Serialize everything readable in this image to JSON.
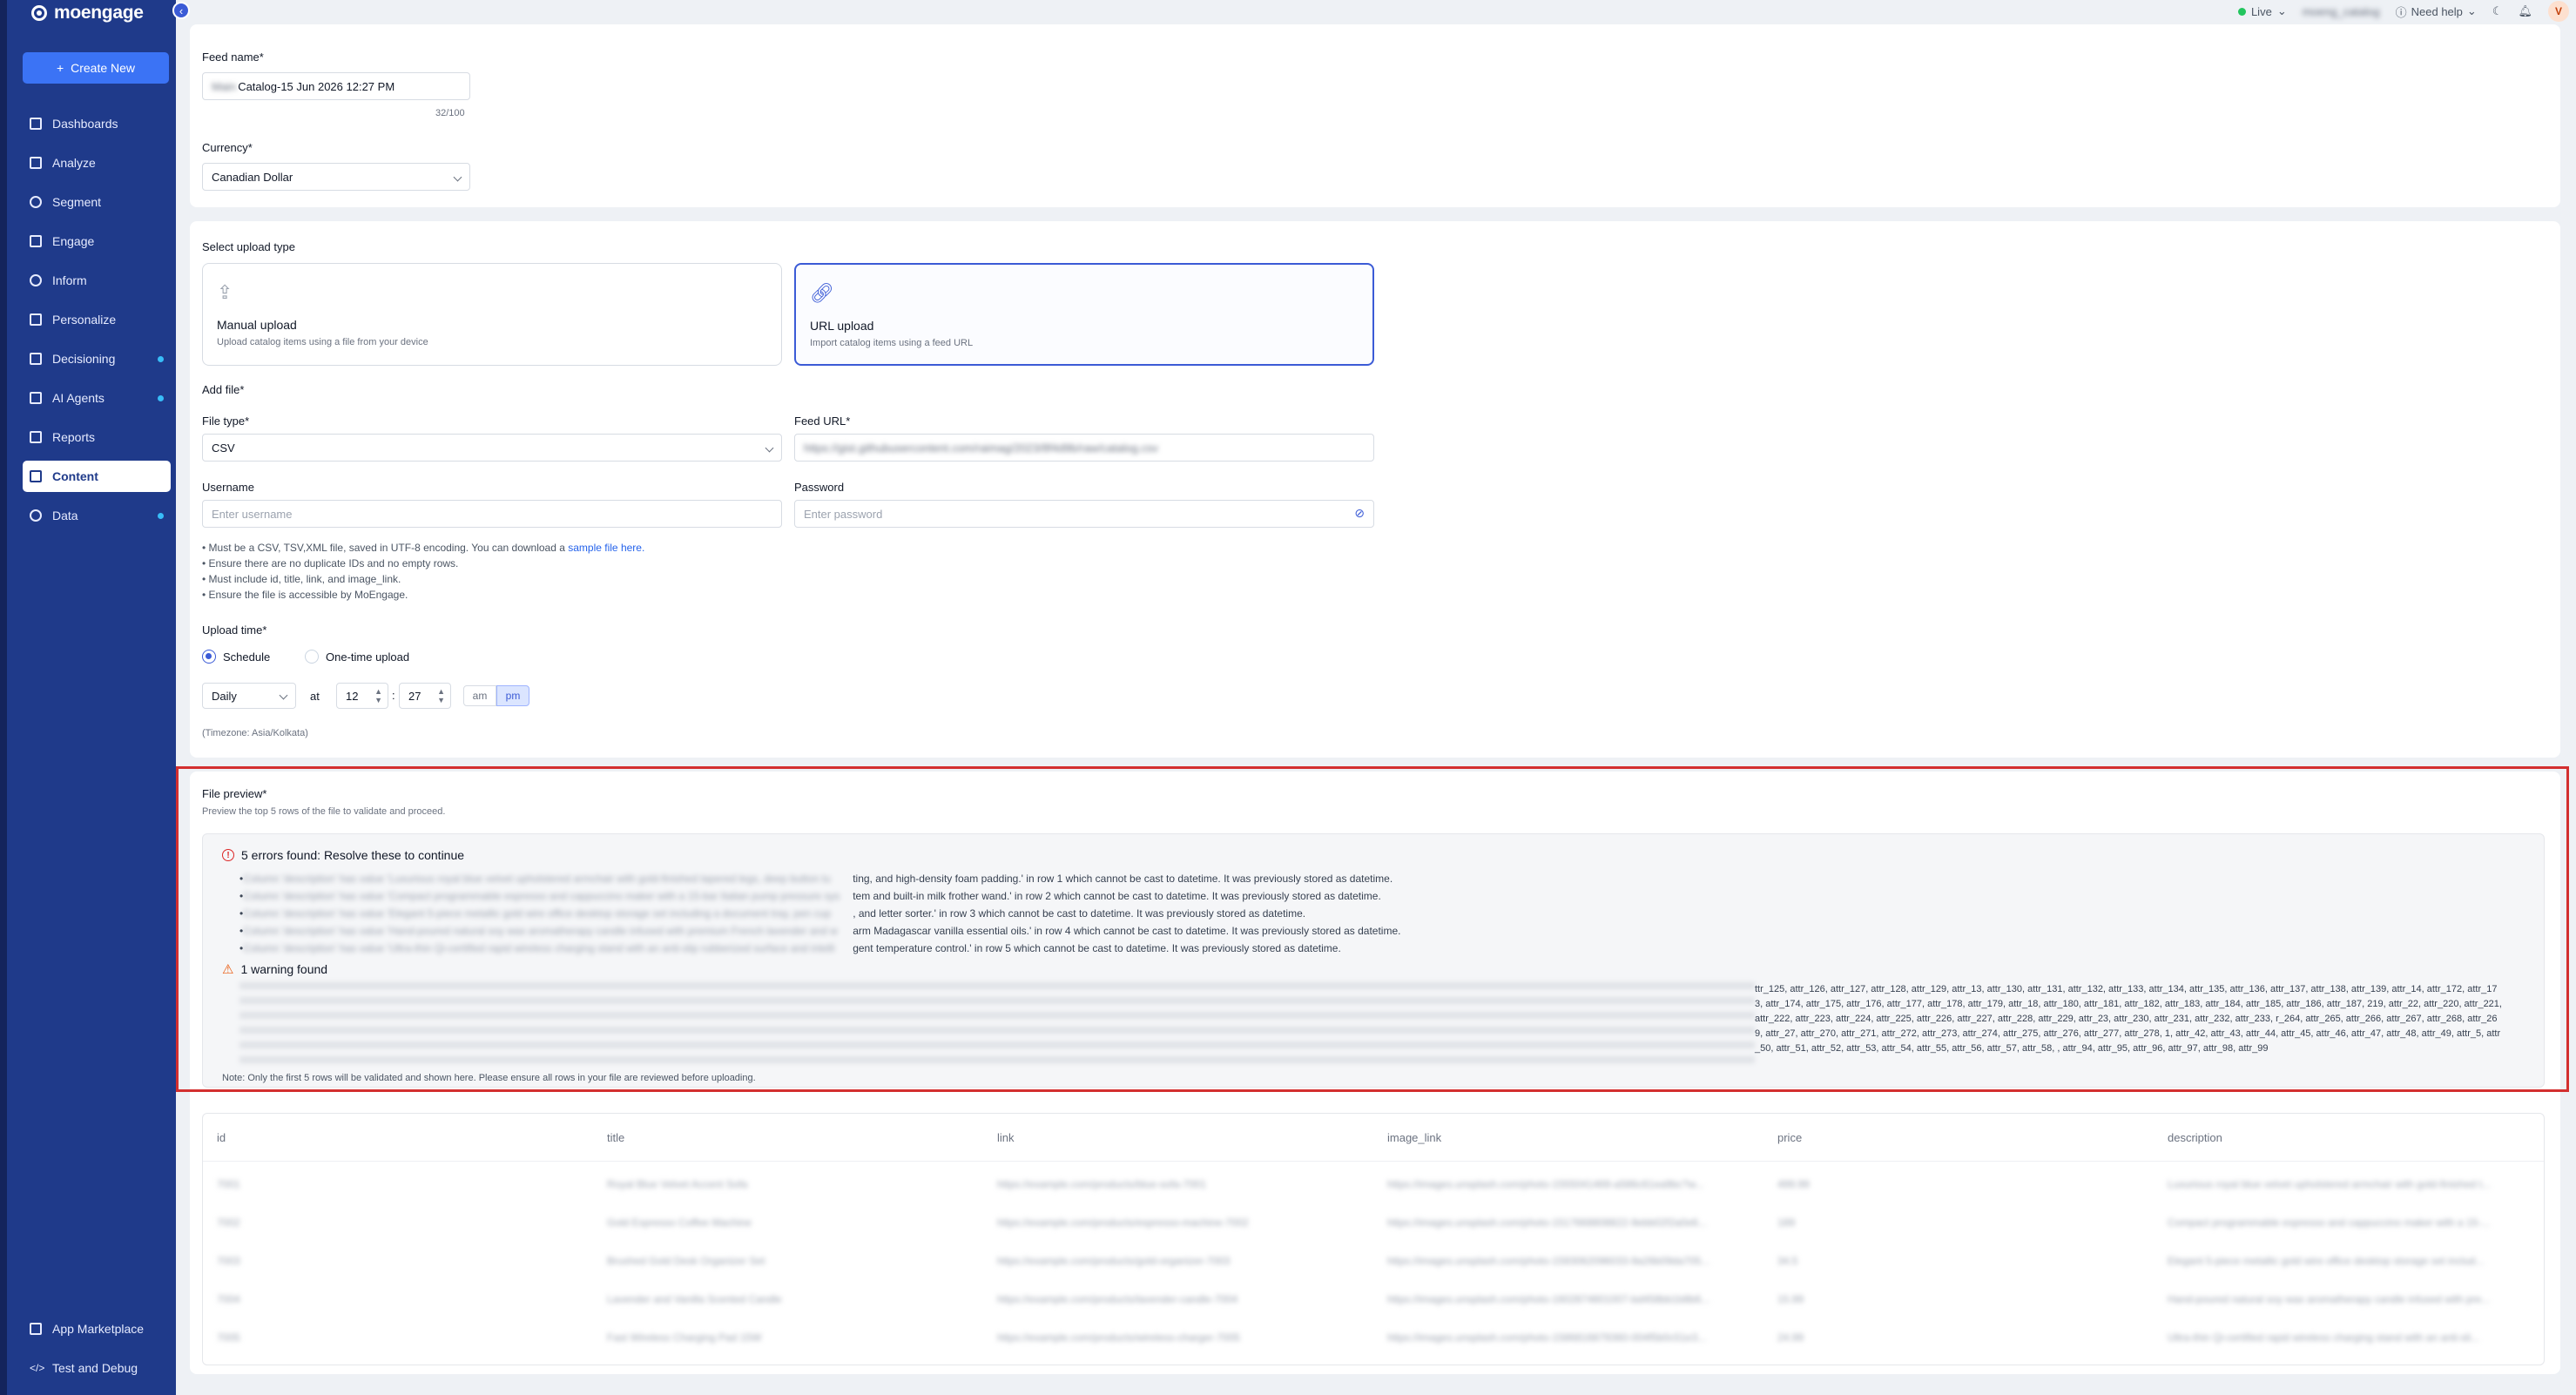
{
  "brand": {
    "logo_text": "moengage"
  },
  "sidebar": {
    "create_label": "Create New",
    "items": [
      {
        "label": "Dashboards",
        "icon": "dashboard-icon"
      },
      {
        "label": "Analyze",
        "icon": "analyze-icon"
      },
      {
        "label": "Segment",
        "icon": "segment-icon"
      },
      {
        "label": "Engage",
        "icon": "megaphone-icon"
      },
      {
        "label": "Inform",
        "icon": "inform-icon"
      },
      {
        "label": "Personalize",
        "icon": "personalize-icon"
      },
      {
        "label": "Decisioning",
        "icon": "sparkle-icon"
      },
      {
        "label": "AI Agents",
        "icon": "robot-icon"
      },
      {
        "label": "Reports",
        "icon": "reports-icon"
      },
      {
        "label": "Content",
        "icon": "content-icon"
      },
      {
        "label": "Data",
        "icon": "database-icon"
      }
    ],
    "bottom_items": [
      {
        "label": "App Marketplace",
        "icon": "marketplace-icon"
      },
      {
        "label": "Test and Debug",
        "icon": "code-icon"
      }
    ]
  },
  "topbar": {
    "live_label": "Live",
    "workspace": "moeng_catalog",
    "help_label": "Need help",
    "avatar_initial": "V"
  },
  "feed": {
    "name_label": "Feed name*",
    "name_prefix": "Main",
    "name_value": "Catalog-15 Jun 2026 12:27 PM",
    "name_counter": "32/100",
    "currency_label": "Currency*",
    "currency_value": "Canadian Dollar"
  },
  "upload": {
    "type_label": "Select upload type",
    "manual_title": "Manual upload",
    "manual_sub": "Upload catalog items using a file from your device",
    "url_title": "URL upload",
    "url_sub": "Import catalog items using a feed URL",
    "add_file_label": "Add file*",
    "file_type_label": "File type*",
    "file_type_value": "CSV",
    "feed_url_label": "Feed URL*",
    "feed_url_value": "https://gist.githubusercontent.com/raimag/2023/8f4d9b/raw/catalog.csv",
    "username_label": "Username",
    "username_placeholder": "Enter username",
    "password_label": "Password",
    "password_placeholder": "Enter password",
    "bullet_1a": "Must be a CSV, TSV,XML file, saved in UTF-8 encoding. You can download a ",
    "bullet_1_link": "sample file here.",
    "bullet_2": "Ensure there are no duplicate IDs and no empty rows.",
    "bullet_3": "Must include id, title, link, and image_link.",
    "bullet_4": "Ensure the file is accessible by MoEngage.",
    "time_label": "Upload time*",
    "schedule_label": "Schedule",
    "onetime_label": "One-time upload",
    "freq_value": "Daily",
    "at_label": "at",
    "hour": "12",
    "colon": ":",
    "minute": "27",
    "am": "am",
    "pm": "pm",
    "timezone": "(Timezone: Asia/Kolkata)"
  },
  "preview": {
    "title": "File preview*",
    "subtitle": "Preview the top 5 rows of the file to validate and proceed.",
    "errors_title": "5 errors found: Resolve these to continue",
    "errors": [
      {
        "blurred": "Column 'description' has value 'Luxurious royal blue velvet upholstered armchair with gold-finished tapered legs, deep button tu",
        "text": "ting, and high-density foam padding.' in row 1 which cannot be cast to datetime. It was previously stored as datetime."
      },
      {
        "blurred": "Column 'description' has value 'Compact programmable espresso and cappuccino maker with a 15-bar Italian pump pressure sys",
        "text": "tem and built-in milk frother wand.' in row 2 which cannot be cast to datetime. It was previously stored as datetime."
      },
      {
        "blurred": "Column 'description' has value 'Elegant 5-piece metallic gold wire office desktop storage set including a document tray, pen cup",
        "text": ", and letter sorter.' in row 3 which cannot be cast to datetime. It was previously stored as datetime."
      },
      {
        "blurred": "Column 'description' has value 'Hand-poured natural soy wax aromatherapy candle infused with premium French lavender and w",
        "text": "arm Madagascar vanilla essential oils.' in row 4 which cannot be cast to datetime. It was previously stored as datetime."
      },
      {
        "blurred": "Column 'description' has value 'Ultra-thin Qi-certified rapid wireless charging stand with an anti-slip rubberized surface and intelli",
        "text": "gent temperature control.' in row 5 which cannot be cast to datetime. It was previously stored as datetime."
      }
    ],
    "warning_title": "1 warning found",
    "warning_text": "ttr_125, attr_126, attr_127, attr_128, attr_129, attr_13, attr_130, attr_131, attr_132, attr_133, attr_134, attr_135, attr_136, attr_137, attr_138, attr_139, attr_14, attr_172, attr_173, attr_174, attr_175, attr_176, attr_177, attr_178, attr_179, attr_18, attr_180, attr_181, attr_182, attr_183, attr_184, attr_185, attr_186, attr_187, 219, attr_22, attr_220, attr_221, attr_222, attr_223, attr_224, attr_225, attr_226, attr_227, attr_228, attr_229, attr_23, attr_230, attr_231, attr_232, attr_233, r_264, attr_265, attr_266, attr_267, attr_268, attr_269, attr_27, attr_270, attr_271, attr_272, attr_273, attr_274, attr_275, attr_276, attr_277, attr_278, 1, attr_42, attr_43, attr_44, attr_45, attr_46, attr_47, attr_48, attr_49, attr_5, attr_50, attr_51, attr_52, attr_53, attr_54, attr_55, attr_56, attr_57, attr_58, , attr_94, attr_95, attr_96, attr_97, attr_98, attr_99",
    "note": "Note: Only the first 5 rows will be validated and shown here. Please ensure all rows in your file are reviewed before uploading."
  },
  "table": {
    "headers": [
      "id",
      "title",
      "link",
      "image_link",
      "price",
      "description"
    ],
    "rows": [
      [
        "7001",
        "Royal Blue Velvet Accent Sofa",
        "https://example.com/products/blue-sofa-7001",
        "https://images.unsplash.com/photo-1555041469-a586c61ea9bc?w...",
        "499.99",
        "Luxurious royal blue velvet upholstered armchair with gold-finished t..."
      ],
      [
        "7002",
        "Gold Espresso Coffee Machine",
        "https://example.com/products/espresso-machine-7002",
        "https://images.unsplash.com/photo-1517668808822-9ebb02f2a0e6...",
        "189",
        "Compact programmable espresso and cappuccino maker with a 15-..."
      ],
      [
        "7003",
        "Brushed Gold Desk Organizer Set",
        "https://example.com/products/gold-organizer-7003",
        "https://images.unsplash.com/photo-1593062096033-9a26b09da705...",
        "34.5",
        "Elegant 5-piece metallic gold wire office desktop storage set includ..."
      ],
      [
        "7004",
        "Lavender and Vanilla Scented Candle",
        "https://example.com/products/lavender-candle-7004",
        "https://images.unsplash.com/photo-1602874801007-bd458bb1b8b6...",
        "15.99",
        "Hand-poured natural soy wax aromatherapy candle infused with pre..."
      ],
      [
        "7005",
        "Fast Wireless Charging Pad 15W",
        "https://example.com/products/wireless-charger-7005",
        "https://images.unsplash.com/photo-1586816879360-004f5b0c51e3...",
        "24.99",
        "Ultra-thin Qi-certified rapid wireless charging stand with an anti-sli..."
      ]
    ]
  },
  "colors": {
    "sidebar": "#1f3a8a",
    "accent": "#3b5bd6",
    "highlight": "#d32f2f",
    "live": "#22c55e"
  }
}
